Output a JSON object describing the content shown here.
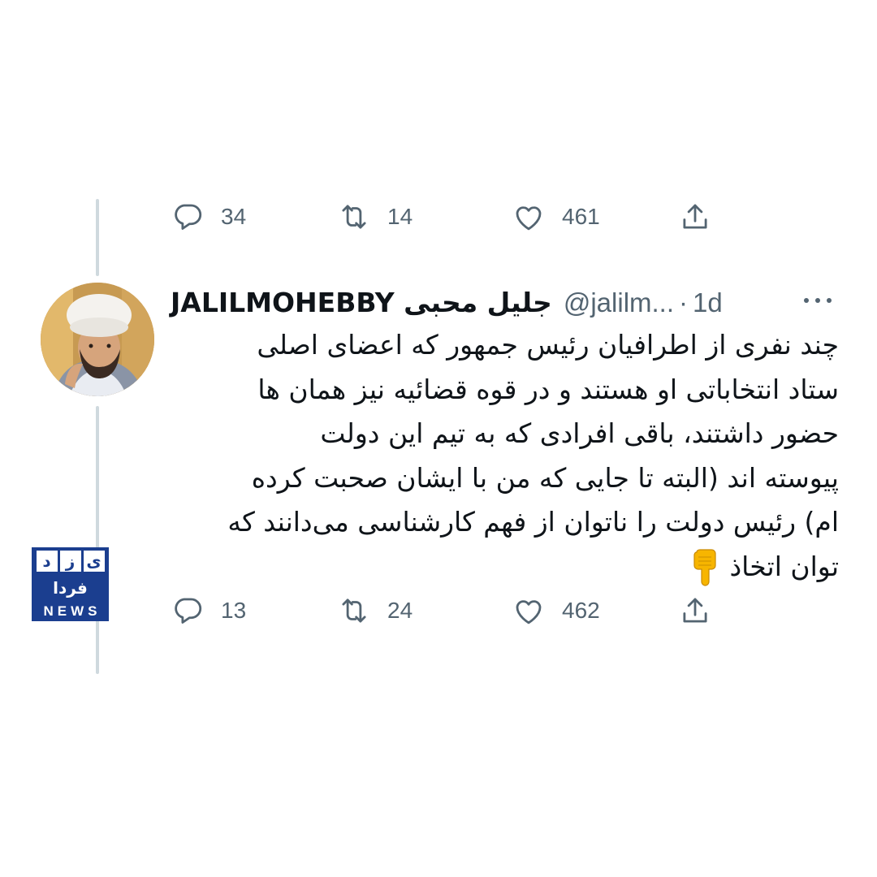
{
  "previous_tweet": {
    "actions": {
      "replies": "34",
      "retweets": "14",
      "likes": "461"
    }
  },
  "tweet": {
    "display_name": "JALILMOHEBBY جلیل محبی",
    "handle": "@jalilm...",
    "separator": "·",
    "time": "1d",
    "text_lines": [
      "چند نفری از اطرافیان رئیس جمهور که اعضای اصلی",
      "ستاد انتخاباتی او هستند و در قوه قضائیه نیز همان ها",
      "حضور داشتند، باقی افرادی که به تیم این دولت",
      "پیوسته اند (البته تا جایی که من با ایشان صحبت کرده",
      "ام) رئیس دولت را ناتوان از فهم کارشناسی می‌دانند که",
      "توان اتخاذ"
    ],
    "emoji": "backhand-index-pointing-down",
    "actions": {
      "replies": "13",
      "retweets": "24",
      "likes": "462"
    }
  },
  "watermark": {
    "letters": [
      "ی",
      "ز",
      "د"
    ],
    "word": "فردا",
    "brand": "NEWS",
    "color": "#1b3e8f"
  },
  "icons": {
    "reply": "reply-icon",
    "retweet": "retweet-icon",
    "like": "heart-icon",
    "share": "share-icon",
    "more": "more-icon"
  },
  "colors": {
    "text": "#0f1419",
    "secondary": "#536471",
    "thread_line": "#cfd9de"
  }
}
